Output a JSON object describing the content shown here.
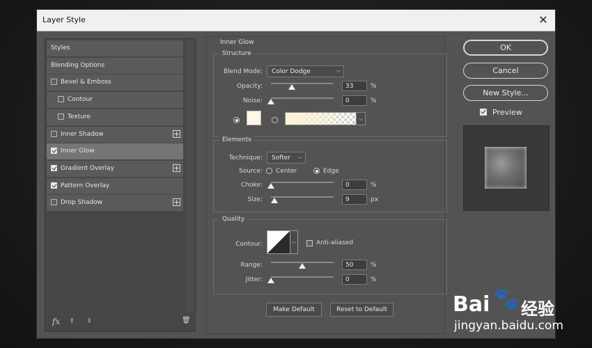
{
  "dialog": {
    "title": "Layer Style"
  },
  "styles_list": {
    "items": [
      {
        "label": "Styles",
        "checkbox": null,
        "indent": false,
        "plus": false,
        "selected": false
      },
      {
        "label": "Blending Options",
        "checkbox": null,
        "indent": false,
        "plus": false,
        "selected": false
      },
      {
        "label": "Bevel & Emboss",
        "checkbox": false,
        "indent": false,
        "plus": false,
        "selected": false
      },
      {
        "label": "Contour",
        "checkbox": false,
        "indent": true,
        "plus": false,
        "selected": false
      },
      {
        "label": "Texture",
        "checkbox": false,
        "indent": true,
        "plus": false,
        "selected": false
      },
      {
        "label": "Inner Shadow",
        "checkbox": false,
        "indent": false,
        "plus": true,
        "selected": false
      },
      {
        "label": "Inner Glow",
        "checkbox": true,
        "indent": false,
        "plus": false,
        "selected": true
      },
      {
        "label": "Gradient Overlay",
        "checkbox": true,
        "indent": false,
        "plus": true,
        "selected": false
      },
      {
        "label": "Pattern Overlay",
        "checkbox": true,
        "indent": false,
        "plus": false,
        "selected": false
      },
      {
        "label": "Drop Shadow",
        "checkbox": false,
        "indent": false,
        "plus": true,
        "selected": false
      }
    ],
    "footer": {
      "fx": "fx",
      "up": "⬆",
      "down": "⬇",
      "trash": "🗑"
    }
  },
  "inner_glow": {
    "title": "Inner Glow",
    "structure": {
      "title": "Structure",
      "blend_mode_label": "Blend Mode:",
      "blend_mode": "Color Dodge",
      "opacity_label": "Opacity:",
      "opacity": "33",
      "opacity_fraction": 0.33,
      "noise_label": "Noise:",
      "noise": "0",
      "noise_fraction": 0.0,
      "percent": "%",
      "glow_color": "#fff8e6",
      "gradient_start": "#fff3d6"
    },
    "elements": {
      "title": "Elements",
      "technique_label": "Technique:",
      "technique": "Softer",
      "source_label": "Source:",
      "source_center": "Center",
      "source_edge": "Edge",
      "source_selected": "Edge",
      "choke_label": "Choke:",
      "choke": "0",
      "choke_fraction": 0.0,
      "size_label": "Size:",
      "size": "9",
      "size_fraction": 0.06,
      "percent": "%",
      "px": "px"
    },
    "quality": {
      "title": "Quality",
      "contour_label": "Contour:",
      "anti_aliased_label": "Anti-aliased",
      "anti_aliased": false,
      "range_label": "Range:",
      "range": "50",
      "range_fraction": 0.5,
      "jitter_label": "Jitter:",
      "jitter": "0",
      "jitter_fraction": 0.0,
      "percent": "%"
    },
    "make_default": "Make Default",
    "reset_default": "Reset to Default"
  },
  "right": {
    "ok": "OK",
    "cancel": "Cancel",
    "new_style": "New Style...",
    "preview_label": "Preview",
    "preview_checked": true
  },
  "watermark": {
    "brand": "Bai",
    "brand2": "经验",
    "url": "jingyan.baidu.com"
  }
}
